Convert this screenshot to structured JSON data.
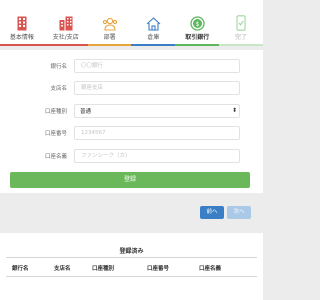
{
  "steps": [
    {
      "label": "基本情報",
      "icon": "building-red-icon",
      "color": "#d9534f"
    },
    {
      "label": "支社/支店",
      "icon": "buildings-red-icon",
      "color": "#d9534f"
    },
    {
      "label": "部署",
      "icon": "people-group-icon",
      "color": "#e8a33c"
    },
    {
      "label": "倉庫",
      "icon": "house-icon",
      "color": "#3a7fc6"
    },
    {
      "label": "取引銀行",
      "icon": "coin-icon",
      "color": "#5cb85c"
    },
    {
      "label": "完了",
      "icon": "mobile-check-icon",
      "color": "#9fd49f"
    }
  ],
  "active_step": "取引銀行",
  "form": {
    "bank_name": {
      "label": "銀行名",
      "placeholder": "〇〇銀行"
    },
    "branch_name": {
      "label": "支店名",
      "placeholder": "銀座支店"
    },
    "account_type": {
      "label": "口座種別",
      "value": "普通"
    },
    "account_number": {
      "label": "口座番号",
      "placeholder": "1234567"
    },
    "account_holder": {
      "label": "口座名義",
      "placeholder": "ファンシーク（カ）"
    },
    "submit_label": "登録"
  },
  "nav": {
    "prev_label": "前へ",
    "next_label": "次へ"
  },
  "registered": {
    "title": "登録済み",
    "columns": [
      "銀行名",
      "支店名",
      "口座種別",
      "口座番号",
      "口座名義"
    ]
  },
  "colors": {
    "submit": "#6ab85a",
    "prev": "#3a7fc6",
    "next_disabled": "#a9c9e7"
  }
}
